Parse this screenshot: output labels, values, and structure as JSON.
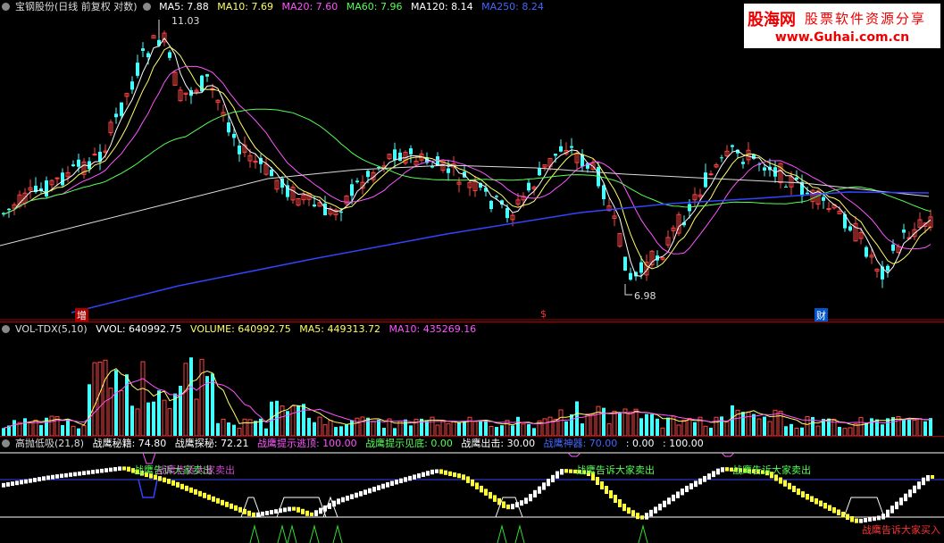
{
  "price_header": {
    "title": "宝钢股份(日线 前复权 对数)",
    "items": [
      {
        "label": "MA5: 7.88",
        "color": "#ffffff"
      },
      {
        "label": "MA10: 7.69",
        "color": "#ffff66"
      },
      {
        "label": "MA20: 7.60",
        "color": "#ff55ff"
      },
      {
        "label": "MA60: 7.96",
        "color": "#55ff55"
      },
      {
        "label": "MA120: 8.14",
        "color": "#ffffff"
      },
      {
        "label": "MA250: 8.24",
        "color": "#4466ff"
      }
    ]
  },
  "logo": {
    "line1": "股海网",
    "line1b": "股票软件资源分享",
    "line2": "www.Guhai.com.cn"
  },
  "price_labels": {
    "high": "11.03",
    "low": "6.98"
  },
  "event_markers": [
    "增",
    "$",
    "财"
  ],
  "volume_header": {
    "title": "VOL-TDX(5,10)",
    "items": [
      {
        "label": "VVOL: 640992.75",
        "color": "#ffffff"
      },
      {
        "label": "VOLUME: 640992.75",
        "color": "#ffff66"
      },
      {
        "label": "MA5: 449313.72",
        "color": "#ffff66"
      },
      {
        "label": "MA10: 435269.16",
        "color": "#ff55ff"
      }
    ]
  },
  "ind_header": {
    "title": "高抛低吸(21,8)",
    "items": [
      {
        "label": "战鹰秘籍: 74.80",
        "color": "#ffffff"
      },
      {
        "label": "战鹰探秘: 72.21",
        "color": "#ffffff"
      },
      {
        "label": "战鹰提示逃顶: 100.00",
        "color": "#ff55ff"
      },
      {
        "label": "战鹰提示见底: 0.00",
        "color": "#55ff55"
      },
      {
        "label": "战鹰出击: 30.00",
        "color": "#ffffff"
      },
      {
        "label": "战鹰神器: 70.00",
        "color": "#4466ff"
      },
      {
        "label": ": 0.00",
        "color": "#ffffff"
      },
      {
        "label": ": 100.00",
        "color": "#ffffff"
      }
    ]
  },
  "ind_labels": {
    "sell1": "战鹰告诉大家卖出",
    "sell1b": "战鹰告诉大家卖出",
    "sell2": "战鹰告诉大家卖出",
    "sell3": "战鹰告诉大家卖出",
    "buy": "战鹰告诉大家买入"
  },
  "colors": {
    "up": "#ff4444",
    "down": "#44ffff",
    "ma5": "#ffffff",
    "ma10": "#ffff66",
    "ma20": "#ff55ff",
    "ma60": "#55ff55",
    "ma120": "#dddddd",
    "ma250": "#3344ff",
    "sep": "#aa0000"
  }
}
